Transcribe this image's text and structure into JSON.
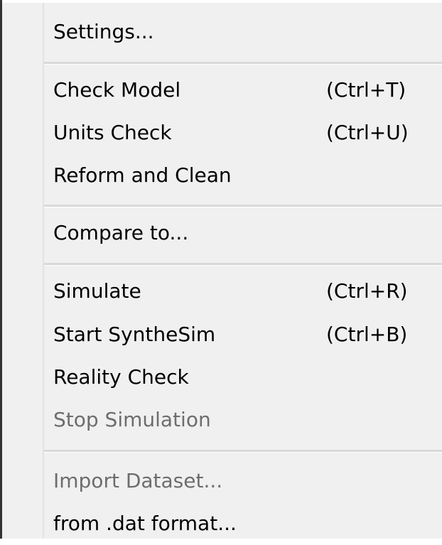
{
  "menu": {
    "settings": {
      "label": "Settings..."
    },
    "check_model": {
      "label": "Check Model",
      "shortcut": "(Ctrl+T)"
    },
    "units_check": {
      "label": "Units Check",
      "shortcut": "(Ctrl+U)"
    },
    "reform_clean": {
      "label": "Reform and Clean"
    },
    "compare_to": {
      "label": "Compare to..."
    },
    "simulate": {
      "label": "Simulate",
      "shortcut": "(Ctrl+R)"
    },
    "start_synthesim": {
      "label": "Start SyntheSim",
      "shortcut": "(Ctrl+B)"
    },
    "reality_check": {
      "label": "Reality Check"
    },
    "stop_simulation": {
      "label": "Stop Simulation",
      "disabled": true
    },
    "import_dataset": {
      "label": "Import Dataset...",
      "disabled": true
    },
    "from_dat_format": {
      "label": "from .dat format..."
    }
  },
  "colors": {
    "background": "#f0f0f0",
    "text": "#000000",
    "disabled_text": "#6d6d6d",
    "separator": "#d9d9d9"
  }
}
